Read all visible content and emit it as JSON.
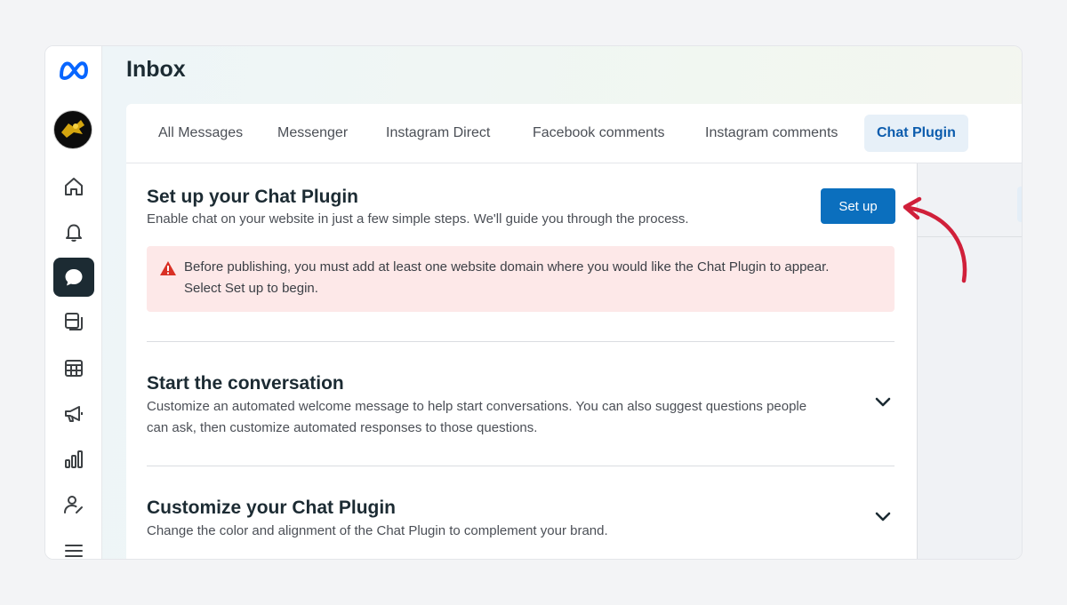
{
  "header": {
    "title": "Inbox"
  },
  "tabs": [
    {
      "label": "All Messages"
    },
    {
      "label": "Messenger"
    },
    {
      "label": "Instagram Direct"
    },
    {
      "label": "Facebook comments"
    },
    {
      "label": "Instagram comments"
    },
    {
      "label": "Chat Plugin"
    }
  ],
  "active_tab": "Chat Plugin",
  "sidebar": {
    "items": [
      {
        "icon": "home-icon"
      },
      {
        "icon": "bell-icon"
      },
      {
        "icon": "chat-bubble-icon",
        "active": true
      },
      {
        "icon": "posts-icon"
      },
      {
        "icon": "calendar-grid-icon"
      },
      {
        "icon": "megaphone-icon"
      },
      {
        "icon": "bar-chart-icon"
      },
      {
        "icon": "user-edit-icon"
      },
      {
        "icon": "menu-icon"
      }
    ]
  },
  "setup": {
    "title": "Set up your Chat Plugin",
    "description": "Enable chat on your website in just a few simple steps. We'll guide you through the process.",
    "button_label": "Set up"
  },
  "alert": {
    "text": "Before publishing, you must add at least one website domain where you would like the Chat Plugin to appear. Select Set up to begin."
  },
  "sections": [
    {
      "title": "Start the conversation",
      "description": "Customize an automated welcome message to help start conversations. You can also suggest questions people can ask, then customize automated responses to those questions."
    },
    {
      "title": "Customize your Chat Plugin",
      "description": "Change the color and alignment of the Chat Plugin to complement your brand."
    }
  ],
  "colors": {
    "accent": "#0b6fbe",
    "alert_bg": "#fde8e8",
    "alert_icon": "#d93025",
    "annotation_arrow": "#d0203a"
  }
}
